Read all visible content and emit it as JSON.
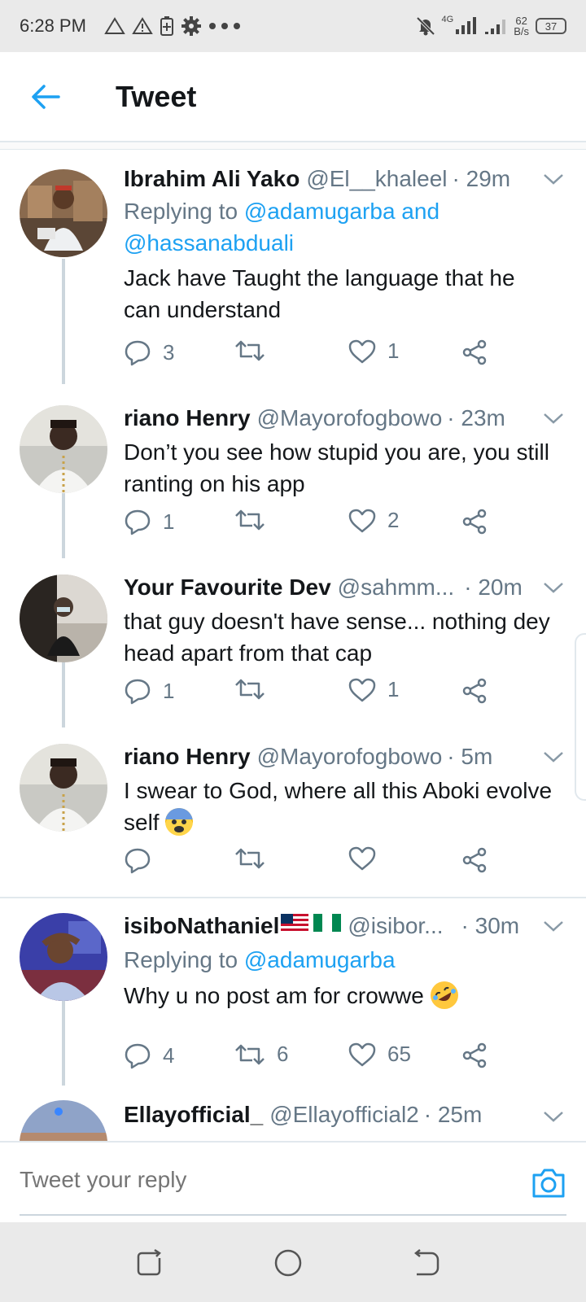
{
  "status_bar": {
    "time": "6:28 PM",
    "network": "4G",
    "speed_value": "62",
    "speed_unit": "B/s",
    "battery": "37"
  },
  "header": {
    "title": "Tweet"
  },
  "tweets": [
    {
      "name": "Ibrahim Ali Yako",
      "handle": "@El__khaleel",
      "time": "· 29m",
      "reply_prefix": "Replying to",
      "reply_mentions": "@adamugarba and @hassanabduali",
      "text": "Jack have Taught the language that he can understand",
      "replies": "3",
      "retweets": "",
      "likes": "1"
    },
    {
      "name": "riano Henry",
      "handle": "@Mayorofogbowo",
      "time": "· 23m",
      "text": "Don’t you see how stupid you are, you still ranting on his app",
      "replies": "1",
      "retweets": "",
      "likes": "2"
    },
    {
      "name": "Your Favourite Dev",
      "handle": "@sahmm...",
      "time": "· 20m",
      "text": "that guy doesn't have sense... nothing dey head apart from that cap",
      "replies": "1",
      "retweets": "",
      "likes": "1"
    },
    {
      "name": "riano Henry",
      "handle": "@Mayorofogbowo",
      "time": "· 5m",
      "text": "I swear to God, where all this Aboki evolve self",
      "emoji": "fearful-face-emoji",
      "replies": "",
      "retweets": "",
      "likes": ""
    },
    {
      "name": "isiboNathaniel",
      "name_flags": [
        "us-flag",
        "nigeria-flag"
      ],
      "handle": "@isibor...",
      "time": "· 30m",
      "reply_prefix": "Replying to",
      "reply_mentions": "@adamugarba",
      "text": "Why u no post am for crowwe",
      "emoji": "rolling-laughing-emoji",
      "replies": "4",
      "retweets": "6",
      "likes": "65"
    },
    {
      "name": "Ellayofficial_",
      "handle": "@Ellayofficial2",
      "time": "· 25m"
    }
  ],
  "reply_box": {
    "placeholder": "Tweet your reply"
  },
  "colors": {
    "accent": "#1da1f2",
    "secondary_text": "#657786",
    "thread_line": "#ccd6dd"
  }
}
